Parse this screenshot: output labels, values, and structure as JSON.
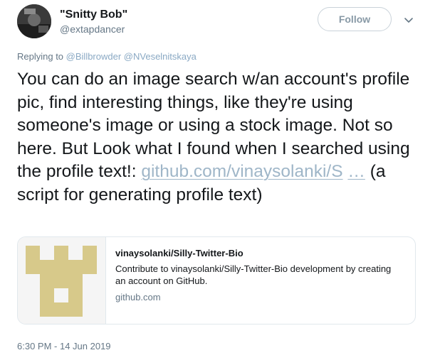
{
  "author": {
    "name": "\"Snitty Bob\"",
    "handle": "@extapdancer",
    "avatar_icon": "person-photo-avatar"
  },
  "header": {
    "follow_label": "Follow",
    "more_icon": "chevron-down-icon"
  },
  "reply": {
    "prefix": "Replying to",
    "mentions": [
      "@Billbrowder",
      "@NVeselnitskaya"
    ]
  },
  "tweet": {
    "text_before": "You can do an image search w/an account's profile pic, find interesting things, like they're using someone's image or using a stock image. Not so here. But Look what I found when I searched using the profile text!: ",
    "link_text": "github.com/vinaysolanki/S",
    "ellipsis": "…",
    "text_after": " (a script for generating profile text)"
  },
  "card": {
    "title": "vinaysolanki/Silly-Twitter-Bio",
    "description": "Contribute to vinaysolanki/Silly-Twitter-Bio development by creating an account on GitHub.",
    "domain": "github.com",
    "thumb_color": "#d7c98a",
    "thumb_icon": "github-identicon"
  },
  "footer": {
    "timestamp": "6:30 PM - 14 Jun 2019"
  },
  "colors": {
    "link": "#9fb6c8",
    "mention": "#8aa9c4",
    "muted": "#657786",
    "text": "#14171a"
  }
}
